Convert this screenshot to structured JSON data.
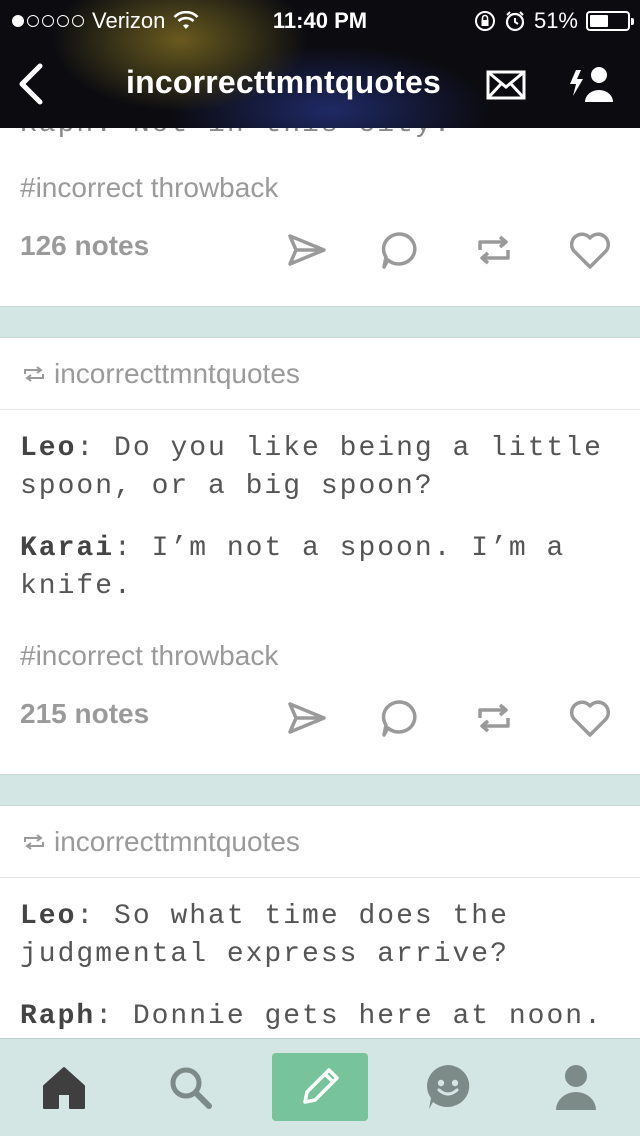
{
  "status": {
    "carrier": "Verizon",
    "time": "11:40 PM",
    "battery": "51%",
    "battery_level": 0.51
  },
  "nav": {
    "title": "incorrecttmntquotes"
  },
  "posts": [
    {
      "partial_line": "Raph: Not in this city.",
      "tag": "#incorrect throwback",
      "notes": "126 notes"
    },
    {
      "reblogged_from": "incorrecttmntquotes",
      "lines": [
        {
          "speaker": "Leo",
          "sep": ": ",
          "text": "Do you like being a little spoon, or a big spoon?"
        },
        {
          "speaker": "Karai",
          "sep": ": ",
          "text": "I’m not a spoon. I’m a knife."
        }
      ],
      "tag": "#incorrect throwback",
      "notes": "215 notes"
    },
    {
      "reblogged_from": "incorrecttmntquotes",
      "lines": [
        {
          "speaker": "Leo",
          "sep": ": ",
          "text": "So what time does the judgmental express arrive?"
        },
        {
          "speaker": "Raph",
          "sep": ": ",
          "text": "Donnie gets here at noon."
        }
      ]
    }
  ],
  "colors": {
    "accent": "#77c39b",
    "background": "#d4e6e3",
    "muted": "#9a9a9a"
  }
}
